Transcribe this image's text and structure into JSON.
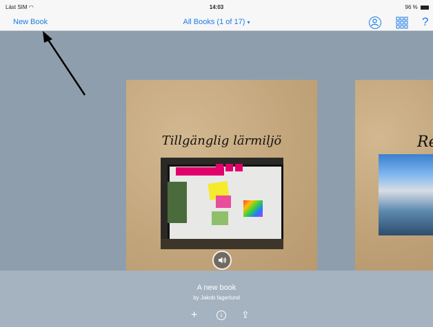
{
  "statusbar": {
    "carrier": "Läst SIM",
    "time": "14:03",
    "battery": "96 %"
  },
  "navbar": {
    "new_book_label": "New Book",
    "title": "All Books (1 of 17)",
    "title_chevron": "▾",
    "help_label": "?"
  },
  "books": {
    "current": {
      "title": "Tillgänglig lärmiljö"
    },
    "next": {
      "title": "Re"
    }
  },
  "selected_book": {
    "name": "A new book",
    "author": "by Jakob fagerlund"
  },
  "toolbar": {
    "add_icon": "+",
    "info_icon": "i",
    "share_icon": "⇪"
  },
  "icons": {
    "user": "user-circle-icon",
    "grid": "grid-view-icon",
    "speaker": "speaker-icon"
  },
  "colors": {
    "accent": "#1b7ce6",
    "background": "#8e9eac"
  }
}
